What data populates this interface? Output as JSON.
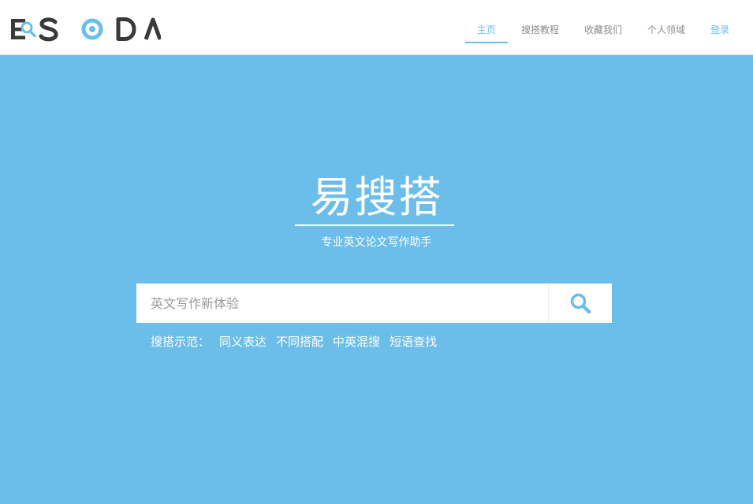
{
  "brand": {
    "logo_letters": [
      "E",
      "S",
      "O",
      "D",
      "A"
    ],
    "accent_color": "#6bbdea",
    "dark_color": "#3a3a3a"
  },
  "nav": {
    "items": [
      {
        "label": "主页",
        "active": true
      },
      {
        "label": "搜搭教程",
        "active": false
      },
      {
        "label": "收藏我们",
        "active": false
      },
      {
        "label": "个人领域",
        "active": false
      }
    ],
    "login_label": "登录"
  },
  "hero": {
    "title": "易搜搭",
    "subtitle": "专业英文论文写作助手"
  },
  "search": {
    "placeholder": "英文写作新体验",
    "value": "",
    "button_icon": "search-icon"
  },
  "examples": {
    "label": "搜搭示范：",
    "links": [
      "同义表达",
      "不同搭配",
      "中英混搜",
      "短语查找"
    ]
  }
}
